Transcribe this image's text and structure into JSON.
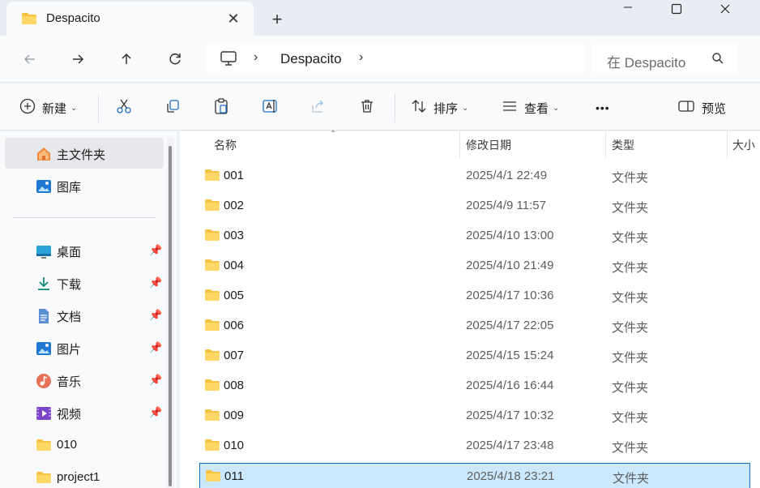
{
  "window": {
    "tab_title": "Despacito",
    "new_tab_symbol": "+",
    "close_symbol": "✕"
  },
  "address": {
    "location": "Despacito",
    "search_placeholder": "在 Despacito"
  },
  "commands": {
    "new_label": "新建",
    "sort_label": "排序",
    "view_label": "查看",
    "more_label": "•••",
    "preview_label": "预览"
  },
  "sidebar": {
    "items": [
      {
        "label": "主文件夹",
        "icon": "home-icon",
        "pinned": false,
        "selected": true
      },
      {
        "label": "图库",
        "icon": "gallery-icon",
        "pinned": false
      },
      {
        "label": "桌面",
        "icon": "desktop-icon",
        "pinned": true
      },
      {
        "label": "下载",
        "icon": "download-icon",
        "pinned": true
      },
      {
        "label": "文档",
        "icon": "document-icon",
        "pinned": true
      },
      {
        "label": "图片",
        "icon": "pictures-icon",
        "pinned": true
      },
      {
        "label": "音乐",
        "icon": "music-icon",
        "pinned": true
      },
      {
        "label": "视频",
        "icon": "video-icon",
        "pinned": true
      },
      {
        "label": "010",
        "icon": "folder-icon",
        "pinned": false
      },
      {
        "label": "project1",
        "icon": "folder-icon",
        "pinned": false
      }
    ]
  },
  "columns": {
    "name": "名称",
    "date": "修改日期",
    "type": "类型",
    "size": "大小"
  },
  "files": [
    {
      "name": "001",
      "date": "2025/4/1 22:49",
      "type": "文件夹"
    },
    {
      "name": "002",
      "date": "2025/4/9 11:57",
      "type": "文件夹"
    },
    {
      "name": "003",
      "date": "2025/4/10 13:00",
      "type": "文件夹"
    },
    {
      "name": "004",
      "date": "2025/4/10 21:49",
      "type": "文件夹"
    },
    {
      "name": "005",
      "date": "2025/4/17 10:36",
      "type": "文件夹"
    },
    {
      "name": "006",
      "date": "2025/4/17 22:05",
      "type": "文件夹"
    },
    {
      "name": "007",
      "date": "2025/4/15 15:24",
      "type": "文件夹"
    },
    {
      "name": "008",
      "date": "2025/4/16 16:44",
      "type": "文件夹"
    },
    {
      "name": "009",
      "date": "2025/4/17 10:32",
      "type": "文件夹"
    },
    {
      "name": "010",
      "date": "2025/4/17 23:48",
      "type": "文件夹"
    },
    {
      "name": "011",
      "date": "2025/4/18 23:21",
      "type": "文件夹",
      "selected": true
    }
  ],
  "colors": {
    "folder": "#f5c242",
    "selection": "#cce8ff",
    "selection_border": "#0f6cbd",
    "accent": "#0f6cbd"
  }
}
